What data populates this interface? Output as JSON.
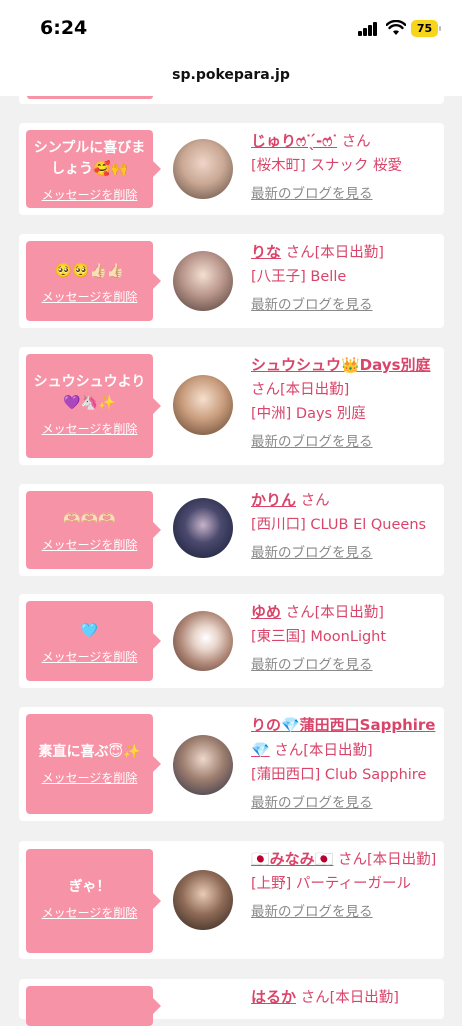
{
  "status": {
    "time": "6:24",
    "battery": "75"
  },
  "browser": {
    "url": "sp.pokepara.jp"
  },
  "entries": [
    {
      "message": "シンプルに喜びましょう🥰🙌",
      "delete": "メッセージを削除",
      "name": "じゅりෆ̇ᐝ‎ ̖́-‬‪ෆ̇ᐝ‬",
      "suffix": "さん",
      "shop": "[桜木町] スナック 桜愛",
      "blog": "最新のブログを見る"
    },
    {
      "message": "🥺🥺👍🏻👍🏻",
      "delete": "メッセージを削除",
      "name": "りな",
      "suffix": "さん[本日出勤]",
      "shop": "[八王子] Belle",
      "blog": "最新のブログを見る"
    },
    {
      "message": "シュウシュウより💜🦄✨",
      "delete": "メッセージを削除",
      "name": "シュウシュウ👑Days別庭",
      "suffix": "さん[本日出勤]",
      "shop": "[中洲] Days 別庭",
      "blog": "最新のブログを見る"
    },
    {
      "message": "🫶🏻🫶🏻🫶🏻",
      "delete": "メッセージを削除",
      "name": "かりん",
      "suffix": "さん",
      "shop": "[西川口] CLUB El Queens",
      "blog": "最新のブログを見る"
    },
    {
      "message": "🩵",
      "delete": "メッセージを削除",
      "name": "ゆめ",
      "suffix": "さん[本日出勤]",
      "shop": "[東三国] MoonLight",
      "blog": "最新のブログを見る"
    },
    {
      "message": "素直に喜ぶ😇✨",
      "delete": "メッセージを削除",
      "name": "りの💎蒲田西口Sapphire💎",
      "suffix": "さん[本日出勤]",
      "shop": "[蒲田西口] Club Sapphire",
      "blog": "最新のブログを見る"
    },
    {
      "message": "ぎゃ！",
      "delete": "メッセージを削除",
      "name": "🇯🇵みなみ🇯🇵",
      "suffix": "さん[本日出勤]",
      "shop": "[上野] パーティーガール",
      "blog": "最新のブログを見る"
    },
    {
      "message": "",
      "delete": "",
      "name": "はるか",
      "suffix": "さん[本日出勤]",
      "shop": "",
      "blog": ""
    }
  ]
}
